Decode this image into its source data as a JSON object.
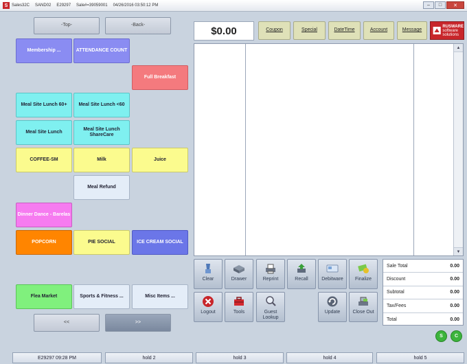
{
  "titlebar": {
    "app": "Sales32C",
    "terminal": "SAND02",
    "employee": "E29297",
    "sale": "Sale#=39059001",
    "datetime": "04/26/2016 03:50:12 PM",
    "window_controls": [
      "–",
      "□",
      "✕"
    ]
  },
  "nav": {
    "top_label": "-Top-",
    "back_label": "-Back-",
    "prev_label": "<<",
    "next_label": ">>"
  },
  "menu_buttons": [
    {
      "label": "Membership ...",
      "color": "#8a8cf2"
    },
    {
      "label": "ATTENDANCE COUNT",
      "color": "#8a8cf2"
    },
    {
      "label": "Full Breakfast",
      "color": "#f47a7e"
    },
    {
      "label": "Meal Site Lunch 60+",
      "color": "#7ff0f0"
    },
    {
      "label": "Meal Site Lunch <60",
      "color": "#7ff0f0"
    },
    {
      "label": "Meal Site Lunch",
      "color": "#7ff0f0"
    },
    {
      "label": "Meal Site Lunch ShareCare",
      "color": "#7ff0f0"
    },
    {
      "label": "COFFEE-SM",
      "color": "#fbfb8e"
    },
    {
      "label": "Milk",
      "color": "#fbfb8e"
    },
    {
      "label": "Juice",
      "color": "#fbfb8e"
    },
    {
      "label": "Meal Refund",
      "color": "#e4edf8"
    },
    {
      "label": "Dinner Dance - Barelas",
      "color": "#f67bf0"
    },
    {
      "label": "POPCORN",
      "color": "#ff8500"
    },
    {
      "label": "PIE SOCIAL",
      "color": "#fbfb8e"
    },
    {
      "label": "ICE CREAM SOCIAL",
      "color": "#6b76e8"
    },
    {
      "label": "Flea Market",
      "color": "#80f07d"
    },
    {
      "label": "Sports & Fitness ...",
      "color": "#e4edf8"
    },
    {
      "label": "Misc Items ...",
      "color": "#e4edf8"
    }
  ],
  "sale_total": "$0.00",
  "top_buttons": [
    {
      "prefix": "",
      "key": "C",
      "rest": "oupon"
    },
    {
      "prefix": "",
      "key": "S",
      "rest": "pecial"
    },
    {
      "prefix": "",
      "key": "D",
      "rest": "ateTime"
    },
    {
      "prefix": "",
      "key": "A",
      "rest": "ccount"
    },
    {
      "prefix": "",
      "key": "M",
      "rest": "essage"
    }
  ],
  "logo": {
    "line1": "RUSWARE",
    "line2": "software",
    "line3": "solutions"
  },
  "function_buttons": [
    {
      "label": "Clear",
      "icon": "broom-icon"
    },
    {
      "label": "Drawer",
      "icon": "drawer-icon"
    },
    {
      "label": "Reprint",
      "icon": "printer-icon"
    },
    {
      "label": "Recall",
      "icon": "recall-icon"
    },
    {
      "label": "Debitware",
      "icon": "card-icon"
    },
    {
      "label": "Finalize",
      "icon": "cash-icon"
    },
    {
      "label": "Logout",
      "icon": "logout-icon"
    },
    {
      "label": "Tools",
      "icon": "toolbox-icon"
    },
    {
      "label": "Guest Lookup",
      "icon": "magnifier-icon"
    },
    {
      "label": "Update",
      "icon": "refresh-icon"
    },
    {
      "label": "Close Out",
      "icon": "register-icon"
    }
  ],
  "summary": [
    {
      "label": "Sale Total",
      "value": "0.00"
    },
    {
      "label": "Discount",
      "value": "0.00"
    },
    {
      "label": "Subtotal",
      "value": "0.00"
    },
    {
      "label": "Tax/Fees",
      "value": "0.00"
    },
    {
      "label": "Total",
      "value": "0.00"
    }
  ],
  "circle_buttons": [
    {
      "label": "S"
    },
    {
      "label": "C"
    }
  ],
  "status": {
    "employee_time": "E29297 09:28 PM",
    "holds": [
      "hold 2",
      "hold 3",
      "hold 4",
      "hold 5"
    ]
  },
  "colors": {
    "background": "#c9d3df",
    "logo": "#c8262b",
    "top_button": "#dfe1b8"
  }
}
